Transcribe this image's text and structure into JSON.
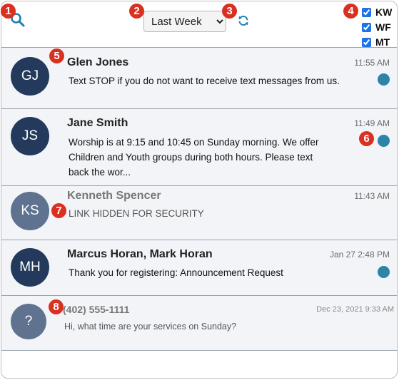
{
  "toolbar": {
    "range_selected": "Last Week",
    "range_options": [
      "Last Week"
    ]
  },
  "filters": [
    {
      "label": "KW",
      "checked": true
    },
    {
      "label": "WF",
      "checked": true
    },
    {
      "label": "MT",
      "checked": true
    }
  ],
  "badges": [
    "1",
    "2",
    "3",
    "4",
    "5",
    "6",
    "7",
    "8"
  ],
  "conversations": [
    {
      "initials": "GJ",
      "name": "Glen Jones",
      "time": "11:55 AM",
      "message": "Text STOP if you do not want to receive text messages from us.",
      "unread": true
    },
    {
      "initials": "JS",
      "name": "Jane Smith",
      "time": "11:49 AM",
      "message": "Worship is at 9:15 and 10:45 on Sunday morning. We offer Children and Youth groups during both hours. Please text back the wor...",
      "unread": true
    },
    {
      "initials": "KS",
      "name": "Kenneth Spencer",
      "time": "11:43 AM",
      "message": "LINK HIDDEN FOR SECURITY",
      "unread": false
    },
    {
      "initials": "MH",
      "name": "Marcus Horan, Mark Horan",
      "time": "Jan 27 2:48 PM",
      "message": "Thank you for registering: Announcement Request",
      "unread": true
    },
    {
      "initials": "?",
      "name": "(402) 555-1111",
      "time": "Dec 23, 2021 9:33 AM",
      "message": "Hi, what time are your services on Sunday?",
      "unread": false
    }
  ],
  "colors": {
    "avatar": "#233a5c",
    "avatar_muted": "#5f7390",
    "unread_dot": "#2e84a8",
    "badge": "#d9301f",
    "row_bg": "#f2f4f7"
  }
}
